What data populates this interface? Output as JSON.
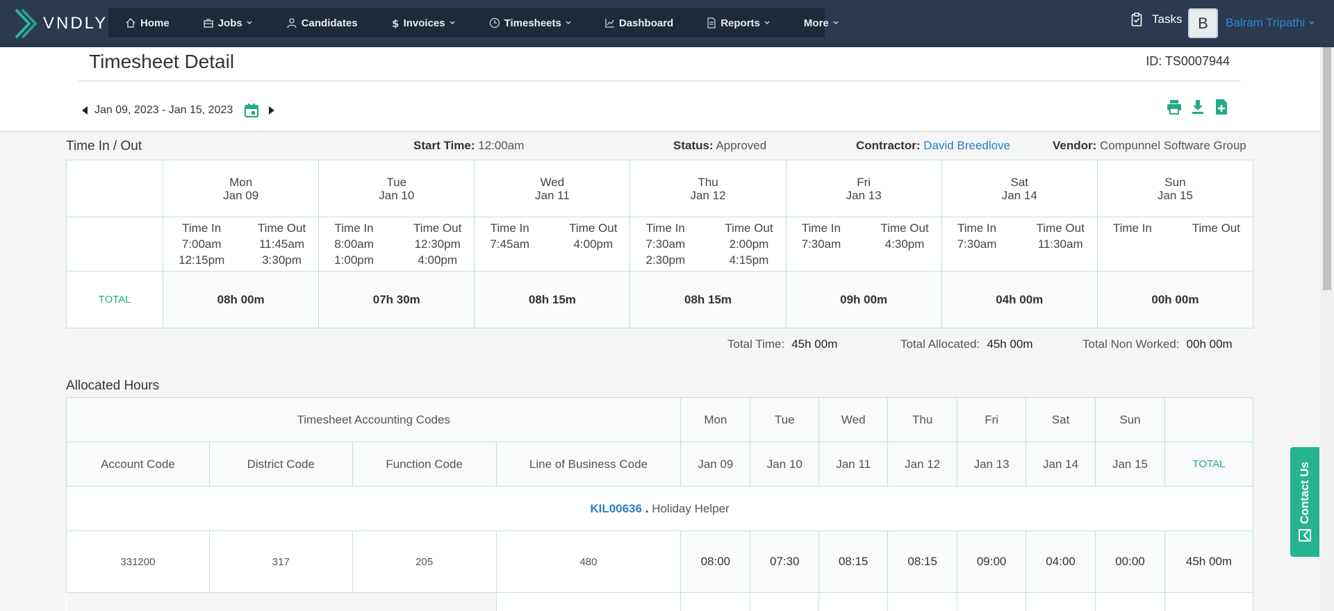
{
  "brand": {
    "name": "VNDLY"
  },
  "nav": {
    "items": [
      {
        "label": "Home"
      },
      {
        "label": "Jobs"
      },
      {
        "label": "Candidates"
      },
      {
        "label": "Invoices"
      },
      {
        "label": "Timesheets"
      },
      {
        "label": "Dashboard"
      },
      {
        "label": "Reports"
      },
      {
        "label": "More"
      }
    ]
  },
  "user": {
    "tasks_label": "Tasks",
    "avatar_letter": "B",
    "name": "Balram Tripathi"
  },
  "page": {
    "title": "Timesheet Detail",
    "id_text": "ID: TS0007944",
    "date_range": "Jan 09, 2023 - Jan 15, 2023"
  },
  "time_in_out": {
    "title": "Time In / Out",
    "start_time_label": "Start Time:",
    "start_time": "12:00am",
    "status_label": "Status:",
    "status": "Approved",
    "contractor_label": "Contractor:",
    "contractor": "David Breedlove",
    "vendor_label": "Vendor:",
    "vendor": "Compunnel Software Group",
    "time_in_label": "Time In",
    "time_out_label": "Time Out",
    "total_label": "TOTAL",
    "days": [
      {
        "dow": "Mon",
        "date": "Jan 09",
        "ins": [
          "7:00am",
          "12:15pm"
        ],
        "outs": [
          "11:45am",
          "3:30pm"
        ],
        "total": "08h 00m"
      },
      {
        "dow": "Tue",
        "date": "Jan 10",
        "ins": [
          "8:00am",
          "1:00pm"
        ],
        "outs": [
          "12:30pm",
          "4:00pm"
        ],
        "total": "07h 30m"
      },
      {
        "dow": "Wed",
        "date": "Jan 11",
        "ins": [
          "7:45am",
          ""
        ],
        "outs": [
          "4:00pm",
          ""
        ],
        "total": "08h 15m"
      },
      {
        "dow": "Thu",
        "date": "Jan 12",
        "ins": [
          "7:30am",
          "2:30pm"
        ],
        "outs": [
          "2:00pm",
          "4:15pm"
        ],
        "total": "08h 15m"
      },
      {
        "dow": "Fri",
        "date": "Jan 13",
        "ins": [
          "7:30am",
          ""
        ],
        "outs": [
          "4:30pm",
          ""
        ],
        "total": "09h 00m"
      },
      {
        "dow": "Sat",
        "date": "Jan 14",
        "ins": [
          "7:30am",
          ""
        ],
        "outs": [
          "11:30am",
          ""
        ],
        "total": "04h 00m"
      },
      {
        "dow": "Sun",
        "date": "Jan 15",
        "ins": [
          "",
          ""
        ],
        "outs": [
          "",
          ""
        ],
        "total": "00h 00m"
      }
    ],
    "summary": {
      "total_time_label": "Total Time:",
      "total_time": "45h 00m",
      "total_allocated_label": "Total Allocated:",
      "total_allocated": "45h 00m",
      "total_non_worked_label": "Total Non Worked:",
      "total_non_worked": "00h 00m"
    }
  },
  "allocated": {
    "title": "Allocated Hours",
    "codes_header": "Timesheet Accounting Codes",
    "code_columns": [
      "Account Code",
      "District Code",
      "Function Code",
      "Line of Business Code"
    ],
    "days": [
      {
        "dow": "Mon",
        "date": "Jan 09"
      },
      {
        "dow": "Tue",
        "date": "Jan 10"
      },
      {
        "dow": "Wed",
        "date": "Jan 11"
      },
      {
        "dow": "Thu",
        "date": "Jan 12"
      },
      {
        "dow": "Fri",
        "date": "Jan 13"
      },
      {
        "dow": "Sat",
        "date": "Jan 14"
      },
      {
        "dow": "Sun",
        "date": "Jan 15"
      }
    ],
    "total_label": "TOTAL",
    "project": {
      "code": "KIL00636",
      "separator": ".",
      "name": "Holiday Helper"
    },
    "rows": [
      {
        "codes": [
          "331200",
          "317",
          "205",
          "480"
        ],
        "hours": [
          "08:00",
          "07:30",
          "08:15",
          "08:15",
          "09:00",
          "04:00",
          "00:00"
        ],
        "total": "45h 00m"
      }
    ]
  },
  "contact": {
    "label": "Contact Us"
  },
  "colors": {
    "navbar": "#2b3a4e",
    "accent": "#26b38f",
    "link": "#2a7fc4",
    "border": "#bfe3dc"
  }
}
